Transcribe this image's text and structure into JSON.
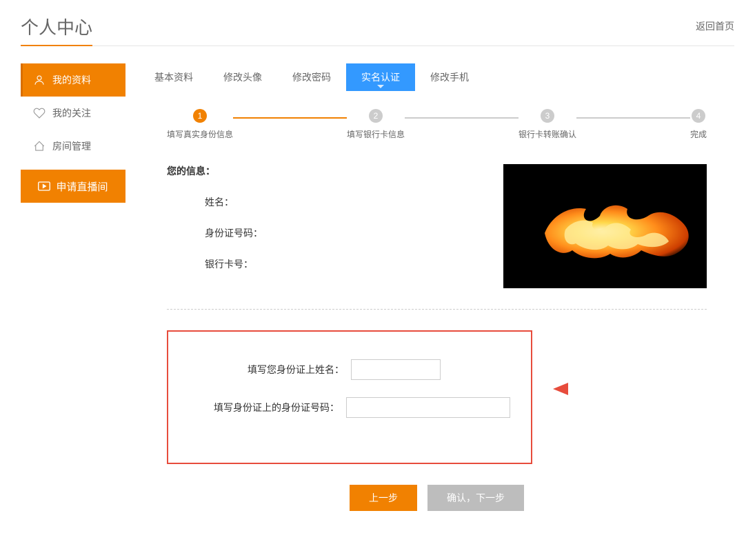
{
  "header": {
    "title": "个人中心",
    "home_link": "返回首页"
  },
  "sidebar": {
    "items": [
      {
        "label": "我的资料"
      },
      {
        "label": "我的关注"
      },
      {
        "label": "房间管理"
      }
    ],
    "apply": "申请直播间"
  },
  "tabs": [
    {
      "label": "基本资料"
    },
    {
      "label": "修改头像"
    },
    {
      "label": "修改密码"
    },
    {
      "label": "实名认证"
    },
    {
      "label": "修改手机"
    }
  ],
  "steps": [
    {
      "num": "1",
      "label": "填写真实身份信息"
    },
    {
      "num": "2",
      "label": "填写银行卡信息"
    },
    {
      "num": "3",
      "label": "银行卡转账确认"
    },
    {
      "num": "4",
      "label": "完成"
    }
  ],
  "info": {
    "title": "您的信息：",
    "name_label": "姓名：",
    "id_label": "身份证号码：",
    "bank_label": "银行卡号："
  },
  "form": {
    "name_label": "填写您身份证上姓名：",
    "id_label": "填写身份证上的身份证号码："
  },
  "buttons": {
    "prev": "上一步",
    "next": "确认，下一步"
  }
}
